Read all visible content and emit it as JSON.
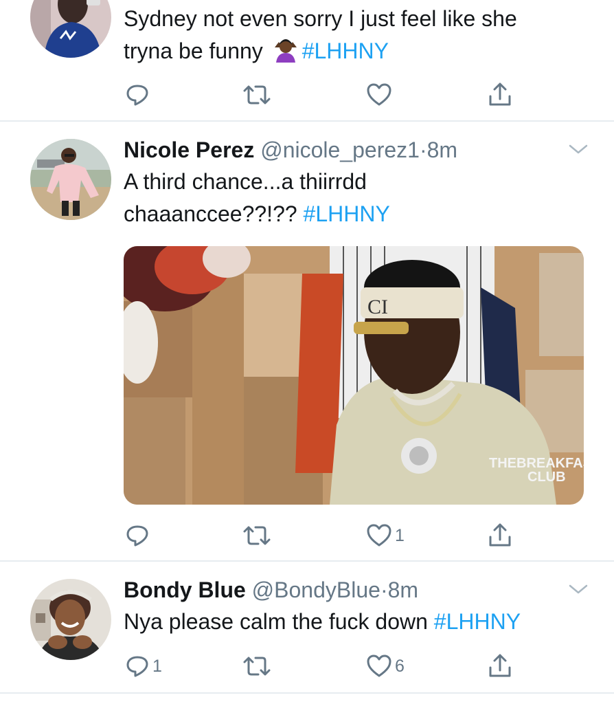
{
  "tweets": [
    {
      "text": "Sydney not even sorry I just feel like she tryna be funny",
      "text_line1": "Sydney not even sorry I just feel like she",
      "text_line2": "tryna be funny",
      "emoji": "person-shrugging-emoji",
      "hashtag": "#LHHNY",
      "counts": {
        "reply": "",
        "retweet": "",
        "like": ""
      }
    },
    {
      "name": "Nicole Perez",
      "handle": "@nicole_perez1",
      "dot": "·",
      "time": "8m",
      "text_line1": "A third chance...a thiirrdd",
      "text_line2": "chaaanccee??!??",
      "hashtag": "#LHHNY",
      "media": {
        "watermark_line1": "THEBREAKFAST",
        "watermark_line2": "CLUB",
        "headband_text": "CI"
      },
      "counts": {
        "reply": "",
        "retweet": "",
        "like": "1"
      }
    },
    {
      "name": "Bondy Blue",
      "handle": "@BondyBlue",
      "dot": "·",
      "time": "8m",
      "text_line1": "Nya please calm the fuck down",
      "hashtag": "#LHHNY",
      "counts": {
        "reply": "1",
        "retweet": "",
        "like": "6"
      }
    }
  ],
  "colors": {
    "hashtag": "#1da1f2",
    "meta": "#657786",
    "divider": "#e6ecf0"
  }
}
